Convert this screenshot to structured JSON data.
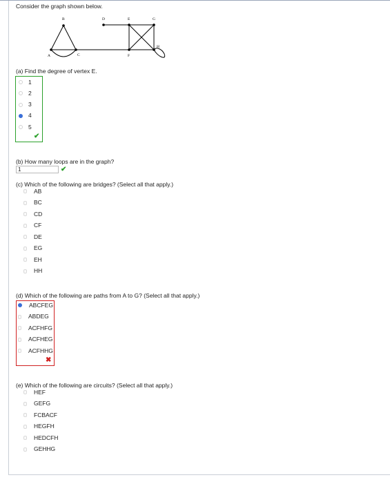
{
  "intro": "Consider the graph shown below.",
  "graph": {
    "labels": {
      "A": "A",
      "B": "B",
      "C": "C",
      "D": "D",
      "E": "E",
      "F": "F",
      "G": "G",
      "H": "H"
    }
  },
  "part_a": {
    "question": "(a) Find the degree of vertex E.",
    "options": [
      "1",
      "2",
      "3",
      "4",
      "5"
    ],
    "selected_index": 3,
    "result": "correct"
  },
  "part_b": {
    "question": "(b) How many loops are in the graph?",
    "answer_value": "1",
    "result": "correct"
  },
  "part_c": {
    "question": "(c) Which of the following are bridges? (Select all that apply.)",
    "options": [
      "AB",
      "BC",
      "CD",
      "CF",
      "DE",
      "EG",
      "EH",
      "HH"
    ]
  },
  "part_d": {
    "question": "(d) Which of the following are paths from A to G? (Select all that apply.)",
    "options": [
      "ABCFEG",
      "ABDEG",
      "ACFHFG",
      "ACFHEG",
      "ACFHHG"
    ],
    "selected_index": 0,
    "result": "incorrect"
  },
  "part_e": {
    "question": "(e) Which of the following are circuits? (Select all that apply.)",
    "options": [
      "HEF",
      "GEFG",
      "FCBACF",
      "HEGFH",
      "HEDCFH",
      "GEHHG"
    ]
  },
  "colors": {
    "correct": "#2aa02a",
    "incorrect": "#d02020",
    "selected": "#3a6fd8"
  },
  "icons": {
    "correct": "check-icon",
    "incorrect": "x-icon"
  }
}
